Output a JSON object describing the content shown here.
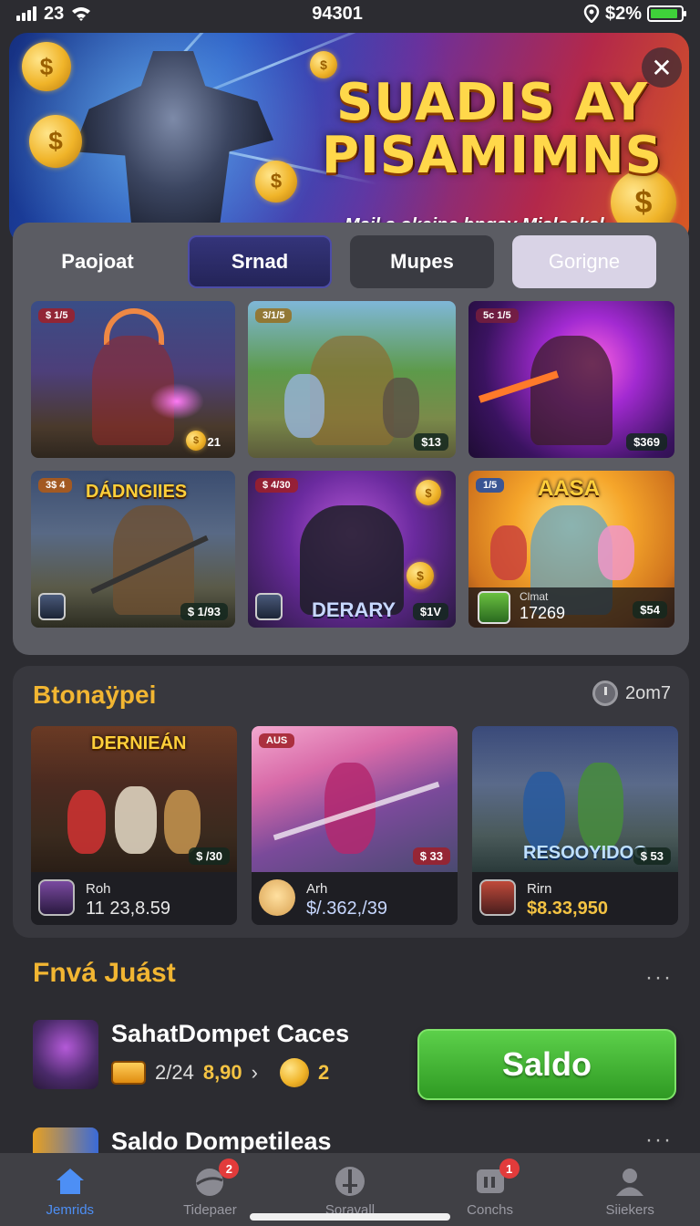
{
  "status_bar": {
    "left_text": "23",
    "time": "94301",
    "battery_text": "$2%",
    "battery_level": 0.92
  },
  "hero": {
    "title_line1": "SUADIS AY",
    "title_line2": "PISAMIMNS",
    "subtitle": "Majl s okeine bngay Mialoakal"
  },
  "tabs": [
    {
      "label": "Paojoat"
    },
    {
      "label": "Srnad"
    },
    {
      "label": "Mupes"
    },
    {
      "label": "Gorigne"
    }
  ],
  "game_grid": [
    {
      "badge": "$ 1/5",
      "value": "21",
      "title": ""
    },
    {
      "badge": "3/1/5",
      "value": "$13",
      "title": ""
    },
    {
      "badge": "5c 1/5",
      "value": "$369",
      "title": ""
    },
    {
      "badge": "3$ 4",
      "value": "$ 1/93",
      "title": "DÁDNGIIES"
    },
    {
      "badge": "$ 4/30",
      "value": "$1V",
      "title": "DERARY"
    },
    {
      "badge": "1/5",
      "value": "$54",
      "title": "AASA",
      "name": "Clmat",
      "number": "17269"
    }
  ],
  "section_featured": {
    "title": "Btonaÿpei",
    "meta": "2om7",
    "cards": [
      {
        "art_title": "DERNIEÁN",
        "badge": "$ /30",
        "name": "Roh",
        "value": "11 23,8.59"
      },
      {
        "art_title": "",
        "badge": "$ 33",
        "name": "Arh",
        "value": "$/.362,/39"
      },
      {
        "art_title": "RESOOYIDOO",
        "badge": "$ 53",
        "name": "Rirn",
        "value": "$8.33,950"
      }
    ]
  },
  "section_list": {
    "title": "Fnvá Juást",
    "more": "···",
    "items": [
      {
        "title": "SahatDompet Caces",
        "stat1": "2/24",
        "stat2": "8,90",
        "arrow": "›",
        "coins": "2",
        "button": "Saldo"
      },
      {
        "title": "Saldo Dompetileas",
        "more": "···"
      }
    ]
  },
  "bottom_nav": [
    {
      "label": "Jemrids",
      "icon": "home-icon",
      "active": true
    },
    {
      "label": "Tidepaer",
      "icon": "ball-icon",
      "badge": "2"
    },
    {
      "label": "Soravall",
      "icon": "sword-icon"
    },
    {
      "label": "Conchs",
      "icon": "chat-icon",
      "badge": "1"
    },
    {
      "label": "Siiekers",
      "icon": "profile-icon"
    }
  ],
  "colors": {
    "accent_gold": "#f2b632",
    "button_green": "#3fb22f",
    "nav_active": "#4d8ff5"
  }
}
